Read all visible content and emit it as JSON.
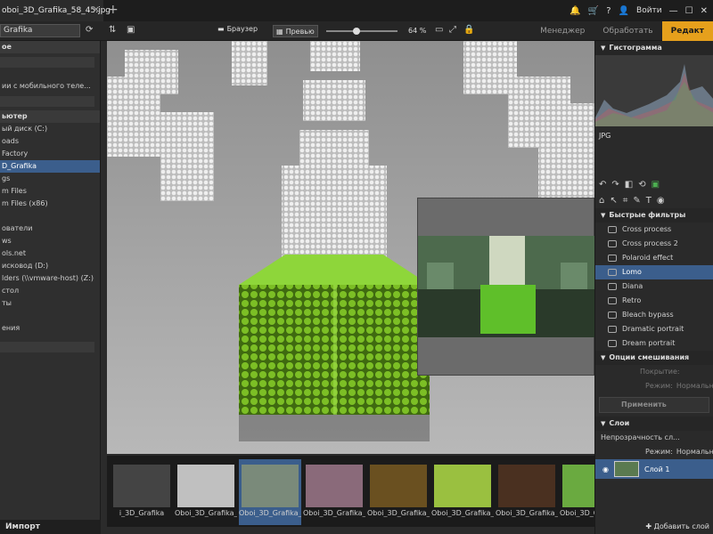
{
  "window": {
    "tab_title": "oboi_3D_Grafika_58_45.jpg",
    "tab_close": "✕",
    "new_tab": "+",
    "right_controls": {
      "bell": "🔔",
      "cart": "🛒",
      "help": "?",
      "user_icon": "👤",
      "login": "Войти",
      "min": "—",
      "max": "☐",
      "close": "✕"
    }
  },
  "toolbar": {
    "path_value": "Grafika",
    "browser_label": "Браузер",
    "preview_label": "Превью",
    "zoom": "64 %",
    "zoom_slider_fraction": 0.4
  },
  "modes": [
    {
      "label": "Менеджер",
      "active": false
    },
    {
      "label": "Обработать",
      "active": false
    },
    {
      "label": "Редакт",
      "active": true
    }
  ],
  "left_panel": {
    "section1_header": "ое",
    "mobile_item": "ии с мобильного теле...",
    "computer_header": "ьютер",
    "items": [
      {
        "label": "ый диск (C:)",
        "selected": false
      },
      {
        "label": "oads",
        "selected": false
      },
      {
        "label": "Factory",
        "selected": false
      },
      {
        "label": "D_Grafika",
        "selected": true
      },
      {
        "label": "gs",
        "selected": false
      },
      {
        "label": "m Files",
        "selected": false
      },
      {
        "label": "m Files (x86)",
        "selected": false
      },
      {
        "label": "",
        "selected": false
      },
      {
        "label": "ователи",
        "selected": false
      },
      {
        "label": "ws",
        "selected": false
      },
      {
        "label": "ols.net",
        "selected": false
      },
      {
        "label": "исковод (D:)",
        "selected": false
      },
      {
        "label": "lders (\\\\vmware-host) (Z:)",
        "selected": false
      },
      {
        "label": "стол",
        "selected": false
      },
      {
        "label": "ты",
        "selected": false
      },
      {
        "label": "",
        "selected": false
      },
      {
        "label": "ения",
        "selected": false
      }
    ],
    "import_label": "Импорт"
  },
  "filmstrip": {
    "thumbs": [
      {
        "label": "i_3D_Grafika",
        "selected": false
      },
      {
        "label": "Oboi_3D_Grafika_",
        "selected": false
      },
      {
        "label": "Oboi_3D_Grafika_",
        "selected": true
      },
      {
        "label": "Oboi_3D_Grafika_",
        "selected": false
      },
      {
        "label": "Oboi_3D_Grafika_",
        "selected": false
      },
      {
        "label": "Oboi_3D_Grafika_",
        "selected": false
      },
      {
        "label": "Oboi_3D_Grafika_",
        "selected": false
      },
      {
        "label": "Oboi_3D_Grafika_",
        "selected": false
      }
    ]
  },
  "right_panel": {
    "histogram_header": "Гистограмма",
    "format": "JPG",
    "quick_filters_header": "Быстрые фильтры",
    "filters": [
      {
        "label": "Cross process",
        "selected": false
      },
      {
        "label": "Cross process 2",
        "selected": false
      },
      {
        "label": "Polaroid effect",
        "selected": false
      },
      {
        "label": "Lomo",
        "selected": true
      },
      {
        "label": "Diana",
        "selected": false
      },
      {
        "label": "Retro",
        "selected": false
      },
      {
        "label": "Bleach bypass",
        "selected": false
      },
      {
        "label": "Dramatic portrait",
        "selected": false
      },
      {
        "label": "Dream portrait",
        "selected": false
      }
    ],
    "blend_header": "Опции смешивания",
    "coverage_label": "Покрытие:",
    "mode_label": "Режим:",
    "mode_value": "Нормальн",
    "apply_label": "Применить",
    "layers_header": "Слои",
    "opacity_label": "Непрозрачность сл...",
    "layer_mode_label": "Режим:",
    "layer_mode_value": "Нормальн",
    "layer_name": "Слой 1",
    "add_layer": "Добавить слой"
  },
  "colors": {
    "accent": "#e6a01c",
    "selection": "#3b5e8c",
    "cube_green": "#6aa81e",
    "cube_grey": "#d9d9d9"
  }
}
